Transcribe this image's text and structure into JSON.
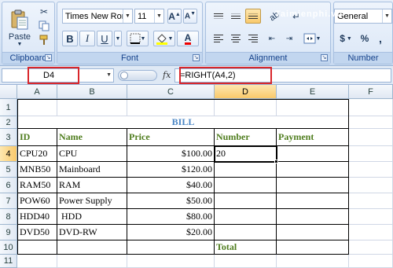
{
  "ribbon": {
    "clipboard": {
      "label": "Clipboard",
      "paste": "Paste"
    },
    "font": {
      "label": "Font",
      "family": "Times New Rom",
      "size": "11",
      "bold": "B",
      "italic": "I",
      "underline": "U",
      "font_color_letter": "A"
    },
    "alignment": {
      "label": "Alignment"
    },
    "number": {
      "label": "Number",
      "format": "General",
      "currency": "$",
      "percent": "%",
      "comma": ","
    }
  },
  "watermark": "Taimienphi.vn",
  "formula_bar": {
    "name_box": "D4",
    "fx": "fx",
    "formula": "=RIGHT(A4,2)"
  },
  "grid": {
    "columns": [
      "A",
      "B",
      "C",
      "D",
      "E",
      "F"
    ],
    "rows": [
      "1",
      "2",
      "3",
      "4",
      "5",
      "6",
      "7",
      "8",
      "9",
      "10",
      "11"
    ],
    "title": "BILL",
    "headers": {
      "id": "ID",
      "name": "Name",
      "price": "Price",
      "number": "Number",
      "payment": "Payment"
    },
    "items": [
      {
        "id": "CPU20",
        "name": "CPU",
        "price": "$100.00",
        "number": "20"
      },
      {
        "id": "MNB50",
        "name": "Mainboard",
        "price": "$120.00",
        "number": ""
      },
      {
        "id": "RAM50",
        "name": "RAM",
        "price": "$40.00",
        "number": ""
      },
      {
        "id": "POW60",
        "name": "Power Supply",
        "price": "$50.00",
        "number": ""
      },
      {
        "id": "HDD40",
        "name": " HDD",
        "price": "$80.00",
        "number": ""
      },
      {
        "id": "DVD50",
        "name": "DVD-RW",
        "price": "$20.00",
        "number": ""
      }
    ],
    "total_label": "Total"
  },
  "colors": {
    "ribbon_bg": "#dbe7f7",
    "selected_header": "#f9c96b",
    "highlight_box": "#d9262b",
    "green_text": "#4f7d1e",
    "bill_blue": "#4a86c5"
  }
}
